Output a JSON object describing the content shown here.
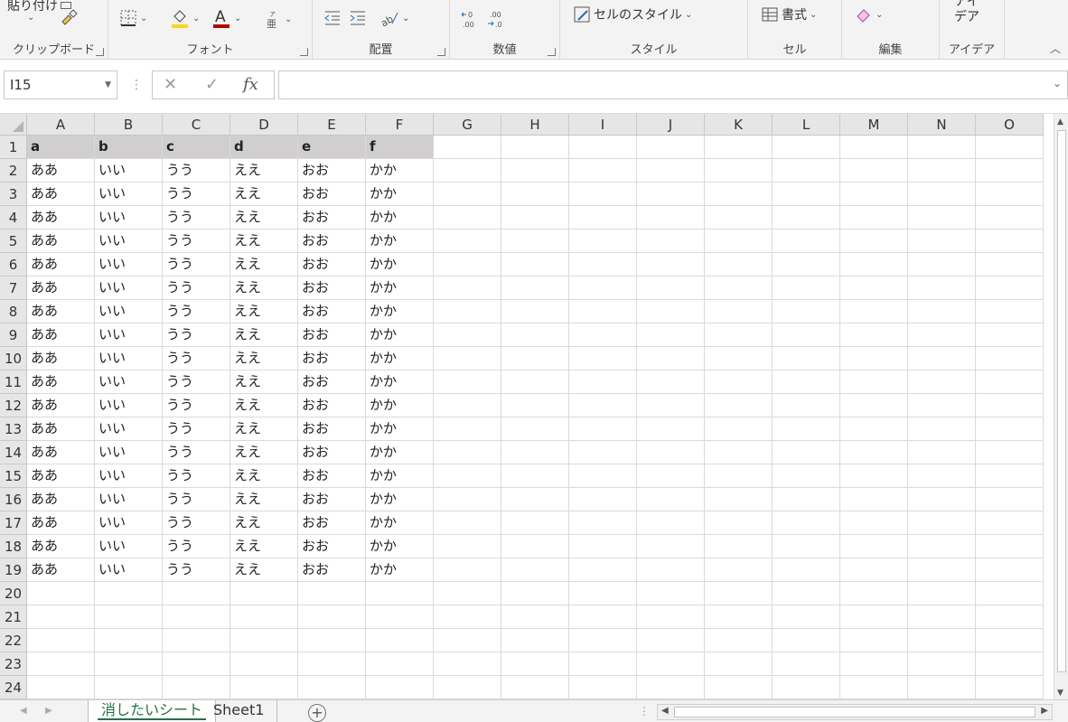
{
  "ribbon": {
    "clipboard": {
      "label": "クリップボード",
      "paste_label": "貼り付け"
    },
    "font": {
      "label": "フォント"
    },
    "alignment": {
      "label": "配置"
    },
    "number": {
      "label": "数値"
    },
    "style": {
      "label": "スタイル",
      "cell_style_label": "セルのスタイル"
    },
    "cells": {
      "label": "セル",
      "format_label": "書式"
    },
    "editing": {
      "label": "編集"
    },
    "ideas": {
      "label": "アイデア",
      "button_label_line1": "アイ",
      "button_label_line2": "デア"
    }
  },
  "formula_bar": {
    "name_box": "I15",
    "formula": ""
  },
  "sheet": {
    "columns": [
      "A",
      "B",
      "C",
      "D",
      "E",
      "F",
      "G",
      "H",
      "I",
      "J",
      "K",
      "L",
      "M",
      "N",
      "O"
    ],
    "rows": [
      "1",
      "2",
      "3",
      "4",
      "5",
      "6",
      "7",
      "8",
      "9",
      "10",
      "11",
      "12",
      "13",
      "14",
      "15",
      "16",
      "17",
      "18",
      "19",
      "20",
      "21",
      "22",
      "23",
      "24"
    ],
    "header_row": [
      "a",
      "b",
      "c",
      "d",
      "e",
      "f"
    ],
    "data_row": [
      "ああ",
      "いい",
      "うう",
      "ええ",
      "おお",
      "かか"
    ],
    "data_row_count": 18
  },
  "tabs": [
    {
      "label": "消したいシート",
      "active": true
    },
    {
      "label": "Sheet1",
      "active": false
    }
  ],
  "colors": {
    "header_fill": "#d0cece",
    "active_tab_accent": "#217346",
    "font_color_accent": "#c00000",
    "fill_color_accent": "#ffd700"
  }
}
